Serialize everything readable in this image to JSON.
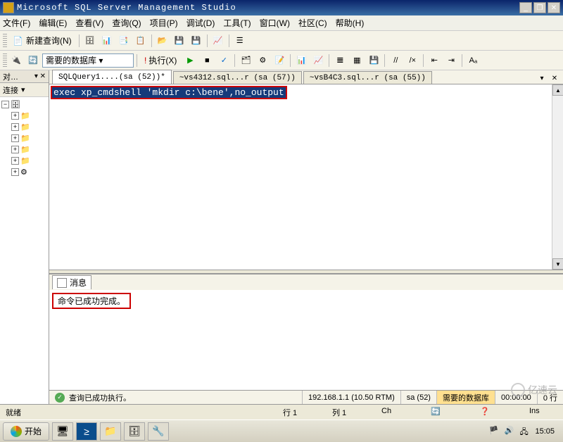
{
  "titlebar": {
    "text": "Microsoft SQL Server Management Studio"
  },
  "menu": {
    "file": "文件(F)",
    "edit": "编辑(E)",
    "view": "查看(V)",
    "query": "查询(Q)",
    "project": "项目(P)",
    "debug": "调试(D)",
    "tools": "工具(T)",
    "window": "窗口(W)",
    "community": "社区(C)",
    "help": "帮助(H)"
  },
  "toolbar1": {
    "new_query": "新建查询(N)"
  },
  "toolbar2": {
    "selected_db": "需要的数据库",
    "execute": "执行(X)"
  },
  "object_explorer": {
    "title": "对…",
    "connect": "连接"
  },
  "tabs": {
    "t1": "SQLQuery1....(sa (52))*",
    "t2": "~vs4312.sql...r (sa (57))",
    "t3": "~vsB4C3.sql...r (sa (55))"
  },
  "editor": {
    "sql": "exec xp_cmdshell 'mkdir c:\\bene',no_output"
  },
  "results": {
    "tab_label": "消息",
    "message": "命令已成功完成。"
  },
  "status": {
    "query_success": "查询已成功执行。",
    "server": "192.168.1.1 (10.50 RTM)",
    "user": "sa (52)",
    "db": "需要的数据库",
    "time": "00:00:00",
    "rows": "0 行"
  },
  "app_status": {
    "ready": "就绪",
    "line": "行 1",
    "col": "列 1",
    "ch": "Ch",
    "ins": "Ins"
  },
  "taskbar": {
    "start": "开始",
    "clock": "15:05"
  },
  "watermark": {
    "text": "亿速云"
  }
}
